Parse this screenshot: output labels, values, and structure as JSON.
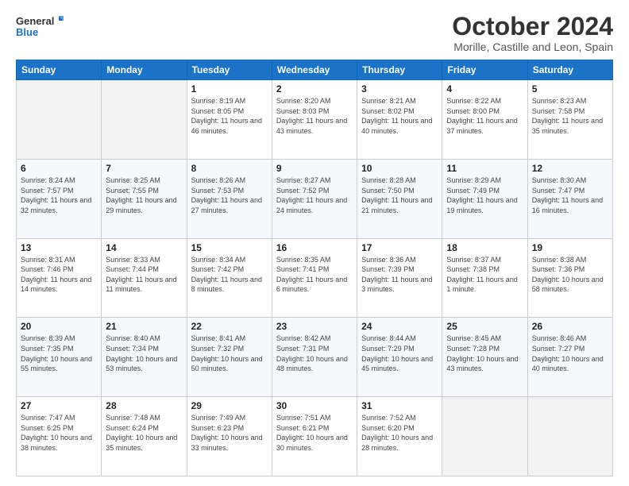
{
  "logo": {
    "line1": "General",
    "line2": "Blue"
  },
  "title": "October 2024",
  "subtitle": "Morille, Castille and Leon, Spain",
  "headers": [
    "Sunday",
    "Monday",
    "Tuesday",
    "Wednesday",
    "Thursday",
    "Friday",
    "Saturday"
  ],
  "weeks": [
    [
      {
        "day": "",
        "info": ""
      },
      {
        "day": "",
        "info": ""
      },
      {
        "day": "1",
        "info": "Sunrise: 8:19 AM\nSunset: 8:05 PM\nDaylight: 11 hours\nand 46 minutes."
      },
      {
        "day": "2",
        "info": "Sunrise: 8:20 AM\nSunset: 8:03 PM\nDaylight: 11 hours\nand 43 minutes."
      },
      {
        "day": "3",
        "info": "Sunrise: 8:21 AM\nSunset: 8:02 PM\nDaylight: 11 hours\nand 40 minutes."
      },
      {
        "day": "4",
        "info": "Sunrise: 8:22 AM\nSunset: 8:00 PM\nDaylight: 11 hours\nand 37 minutes."
      },
      {
        "day": "5",
        "info": "Sunrise: 8:23 AM\nSunset: 7:58 PM\nDaylight: 11 hours\nand 35 minutes."
      }
    ],
    [
      {
        "day": "6",
        "info": "Sunrise: 8:24 AM\nSunset: 7:57 PM\nDaylight: 11 hours\nand 32 minutes."
      },
      {
        "day": "7",
        "info": "Sunrise: 8:25 AM\nSunset: 7:55 PM\nDaylight: 11 hours\nand 29 minutes."
      },
      {
        "day": "8",
        "info": "Sunrise: 8:26 AM\nSunset: 7:53 PM\nDaylight: 11 hours\nand 27 minutes."
      },
      {
        "day": "9",
        "info": "Sunrise: 8:27 AM\nSunset: 7:52 PM\nDaylight: 11 hours\nand 24 minutes."
      },
      {
        "day": "10",
        "info": "Sunrise: 8:28 AM\nSunset: 7:50 PM\nDaylight: 11 hours\nand 21 minutes."
      },
      {
        "day": "11",
        "info": "Sunrise: 8:29 AM\nSunset: 7:49 PM\nDaylight: 11 hours\nand 19 minutes."
      },
      {
        "day": "12",
        "info": "Sunrise: 8:30 AM\nSunset: 7:47 PM\nDaylight: 11 hours\nand 16 minutes."
      }
    ],
    [
      {
        "day": "13",
        "info": "Sunrise: 8:31 AM\nSunset: 7:46 PM\nDaylight: 11 hours\nand 14 minutes."
      },
      {
        "day": "14",
        "info": "Sunrise: 8:33 AM\nSunset: 7:44 PM\nDaylight: 11 hours\nand 11 minutes."
      },
      {
        "day": "15",
        "info": "Sunrise: 8:34 AM\nSunset: 7:42 PM\nDaylight: 11 hours\nand 8 minutes."
      },
      {
        "day": "16",
        "info": "Sunrise: 8:35 AM\nSunset: 7:41 PM\nDaylight: 11 hours\nand 6 minutes."
      },
      {
        "day": "17",
        "info": "Sunrise: 8:36 AM\nSunset: 7:39 PM\nDaylight: 11 hours\nand 3 minutes."
      },
      {
        "day": "18",
        "info": "Sunrise: 8:37 AM\nSunset: 7:38 PM\nDaylight: 11 hours\nand 1 minute."
      },
      {
        "day": "19",
        "info": "Sunrise: 8:38 AM\nSunset: 7:36 PM\nDaylight: 10 hours\nand 58 minutes."
      }
    ],
    [
      {
        "day": "20",
        "info": "Sunrise: 8:39 AM\nSunset: 7:35 PM\nDaylight: 10 hours\nand 55 minutes."
      },
      {
        "day": "21",
        "info": "Sunrise: 8:40 AM\nSunset: 7:34 PM\nDaylight: 10 hours\nand 53 minutes."
      },
      {
        "day": "22",
        "info": "Sunrise: 8:41 AM\nSunset: 7:32 PM\nDaylight: 10 hours\nand 50 minutes."
      },
      {
        "day": "23",
        "info": "Sunrise: 8:42 AM\nSunset: 7:31 PM\nDaylight: 10 hours\nand 48 minutes."
      },
      {
        "day": "24",
        "info": "Sunrise: 8:44 AM\nSunset: 7:29 PM\nDaylight: 10 hours\nand 45 minutes."
      },
      {
        "day": "25",
        "info": "Sunrise: 8:45 AM\nSunset: 7:28 PM\nDaylight: 10 hours\nand 43 minutes."
      },
      {
        "day": "26",
        "info": "Sunrise: 8:46 AM\nSunset: 7:27 PM\nDaylight: 10 hours\nand 40 minutes."
      }
    ],
    [
      {
        "day": "27",
        "info": "Sunrise: 7:47 AM\nSunset: 6:25 PM\nDaylight: 10 hours\nand 38 minutes."
      },
      {
        "day": "28",
        "info": "Sunrise: 7:48 AM\nSunset: 6:24 PM\nDaylight: 10 hours\nand 35 minutes."
      },
      {
        "day": "29",
        "info": "Sunrise: 7:49 AM\nSunset: 6:23 PM\nDaylight: 10 hours\nand 33 minutes."
      },
      {
        "day": "30",
        "info": "Sunrise: 7:51 AM\nSunset: 6:21 PM\nDaylight: 10 hours\nand 30 minutes."
      },
      {
        "day": "31",
        "info": "Sunrise: 7:52 AM\nSunset: 6:20 PM\nDaylight: 10 hours\nand 28 minutes."
      },
      {
        "day": "",
        "info": ""
      },
      {
        "day": "",
        "info": ""
      }
    ]
  ]
}
